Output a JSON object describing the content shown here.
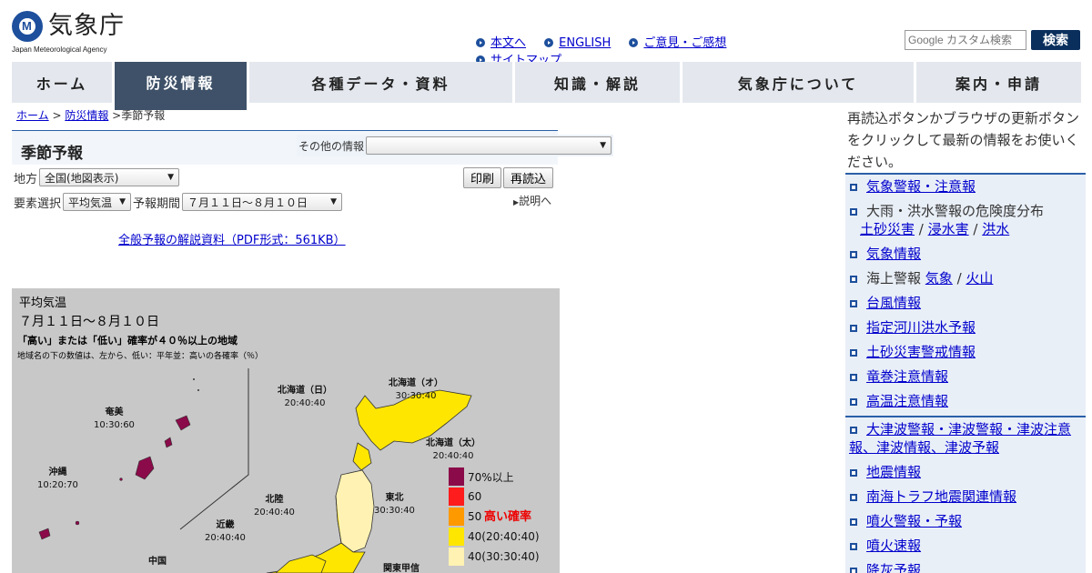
{
  "header": {
    "logo_text": "気象庁",
    "logo_sub": "Japan Meteorological Agency",
    "links": [
      "本文へ",
      "ENGLISH",
      "ご意見・ご感想",
      "サイトマップ"
    ],
    "search_placeholder": "Google カスタム検索",
    "search_button": "検索"
  },
  "nav": [
    "ホーム",
    "防災情報",
    "各種データ・資料",
    "知識・解説",
    "気象庁について",
    "案内・申請"
  ],
  "breadcrumb": {
    "home": "ホーム",
    "sep1": " > ",
    "bosai": "防災情報",
    "sep2": " >",
    "current": "季節予報"
  },
  "page_title": "季節予報",
  "other_info_label": "その他の情報",
  "region_label": "地方",
  "region_value": "全国(地図表示)",
  "element_label": "要素選択",
  "element_value": "平均気温",
  "period_label": "予報期間",
  "period_value": "７月１１日～８月１０日",
  "print_button": "印刷",
  "reload_button": "再読込",
  "explain_link": "説明へ",
  "pdf_link": "全般予報の解説資料（PDF形式：561KB）",
  "map": {
    "title": "平均気温",
    "period": "７月１１日～８月１０日",
    "condition": "「高い」または「低い」確率が４０％以上の地域",
    "note": "地域名の下の数値は、左から、低い：平年並：高いの各確率（％）",
    "regions": [
      {
        "name": "北海道（オ）",
        "vals": "30:30:40"
      },
      {
        "name": "北海道（日）",
        "vals": "20:40:40"
      },
      {
        "name": "北海道（太）",
        "vals": "20:40:40"
      },
      {
        "name": "奄美",
        "vals": "10:30:60"
      },
      {
        "name": "沖縄",
        "vals": "10:20:70"
      },
      {
        "name": "北陸",
        "vals": "20:40:40"
      },
      {
        "name": "東北",
        "vals": "30:30:40"
      },
      {
        "name": "近畿",
        "vals": "20:40:40"
      },
      {
        "name": "中国",
        "vals": ""
      },
      {
        "name": "関東甲信",
        "vals": ""
      }
    ],
    "legend": [
      {
        "label": "70%以上",
        "color": "#8b0a4a"
      },
      {
        "label": "60",
        "color": "#ff1c1c"
      },
      {
        "label": "50",
        "color": "#ff9900"
      },
      {
        "label": "40(20:40:40)",
        "color": "#ffe600"
      },
      {
        "label": "40(30:30:40)",
        "color": "#fff2b3"
      }
    ],
    "legend_high": "高い確率"
  },
  "sidebar": {
    "note": "再読込ボタンかブラウザの更新ボタンをクリックして最新の情報をお使いください。",
    "items": [
      {
        "label": "気象警報・注意報"
      },
      {
        "label": "大雨・洪水警報の危険度分布"
      },
      {
        "label": "気象情報"
      },
      {
        "label": "海上警報"
      },
      {
        "label": "台風情報"
      },
      {
        "label": "指定河川洪水予報"
      },
      {
        "label": "土砂災害警戒情報"
      },
      {
        "label": "竜巻注意情報"
      },
      {
        "label": "高温注意情報"
      },
      {
        "label": "大津波警報・津波警報・津波注意報、津波情報、津波予報"
      },
      {
        "label": "地震情報"
      },
      {
        "label": "南海トラフ地震関連情報"
      },
      {
        "label": "噴火警報・予報"
      },
      {
        "label": "噴火速報"
      },
      {
        "label": "降灰予報"
      }
    ],
    "sub_dosha": "土砂災害",
    "sub_shinsui": "浸水害",
    "sub_kouzui": "洪水",
    "sub_kishou": "気象",
    "sub_kazan": "火山",
    "slash": " / "
  }
}
